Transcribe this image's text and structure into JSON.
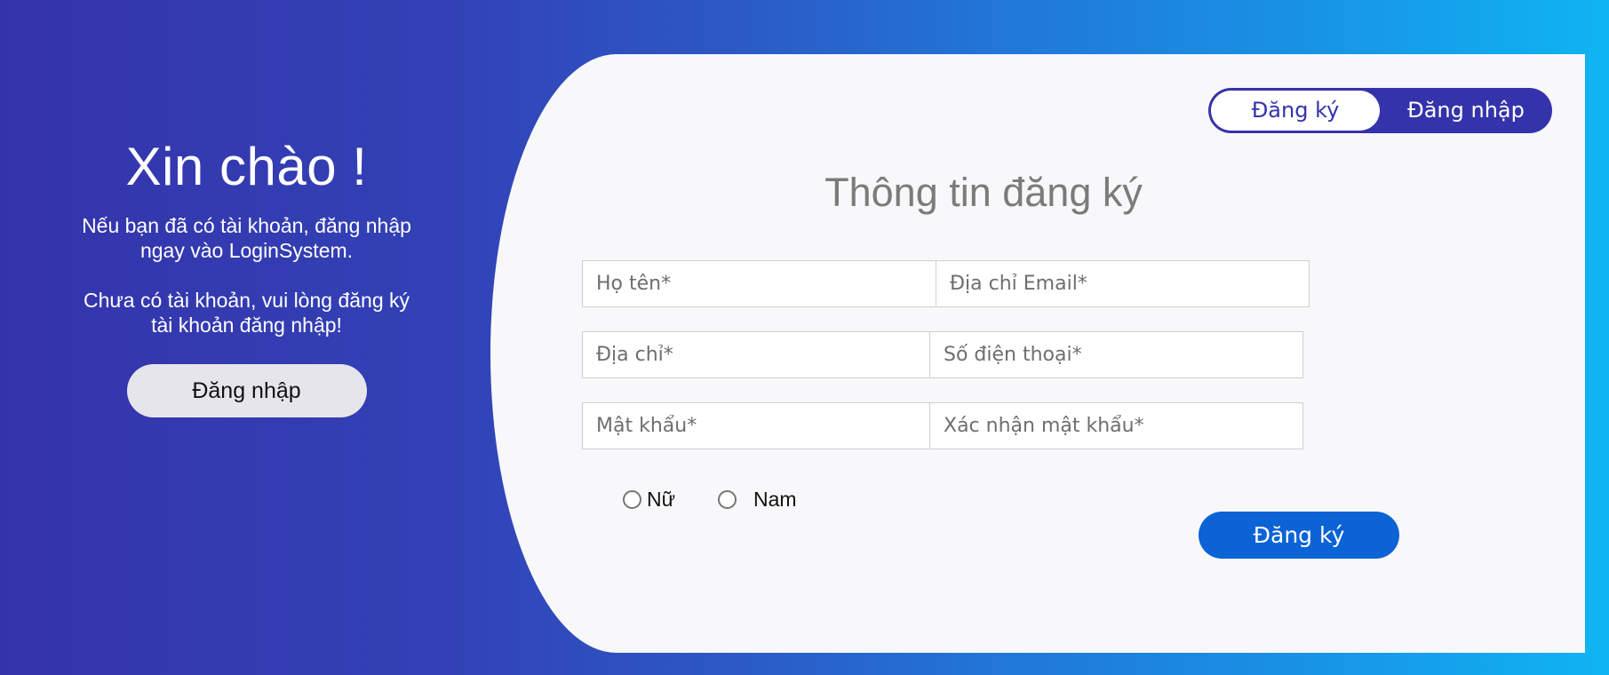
{
  "welcome": {
    "title": "Xin chào !",
    "message_login": "Nếu bạn đã có tài khoản, đăng nhập ngay vào LoginSystem.",
    "message_register": "Chưa có tài khoản, vui lòng đăng ký tài khoản đăng nhập!",
    "login_button": "Đăng nhập"
  },
  "toggle": {
    "register_label": "Đăng ký",
    "login_label": "Đăng nhập",
    "active": "register"
  },
  "form": {
    "title": "Thông tin đăng ký",
    "fields": {
      "full_name": {
        "placeholder": "Họ tên*",
        "value": ""
      },
      "email": {
        "placeholder": "Địa chỉ Email*",
        "value": ""
      },
      "address": {
        "placeholder": "Địa chỉ*",
        "value": ""
      },
      "phone": {
        "placeholder": "Số điện thoại*",
        "value": ""
      },
      "password": {
        "placeholder": "Mật khẩu*",
        "value": ""
      },
      "confirm_password": {
        "placeholder": "Xác nhận mật khẩu*",
        "value": ""
      }
    },
    "gender": {
      "options": [
        "Nữ",
        "Nam"
      ],
      "selected": null
    },
    "submit_label": "Đăng ký"
  },
  "colors": {
    "gradient_start": "#3533ab",
    "gradient_end": "#0fb4f3",
    "card_bg": "#f8f8fa",
    "toggle_bg": "#3533ab",
    "submit_bg": "#0b63d6",
    "title_text": "#7b7b7b"
  }
}
